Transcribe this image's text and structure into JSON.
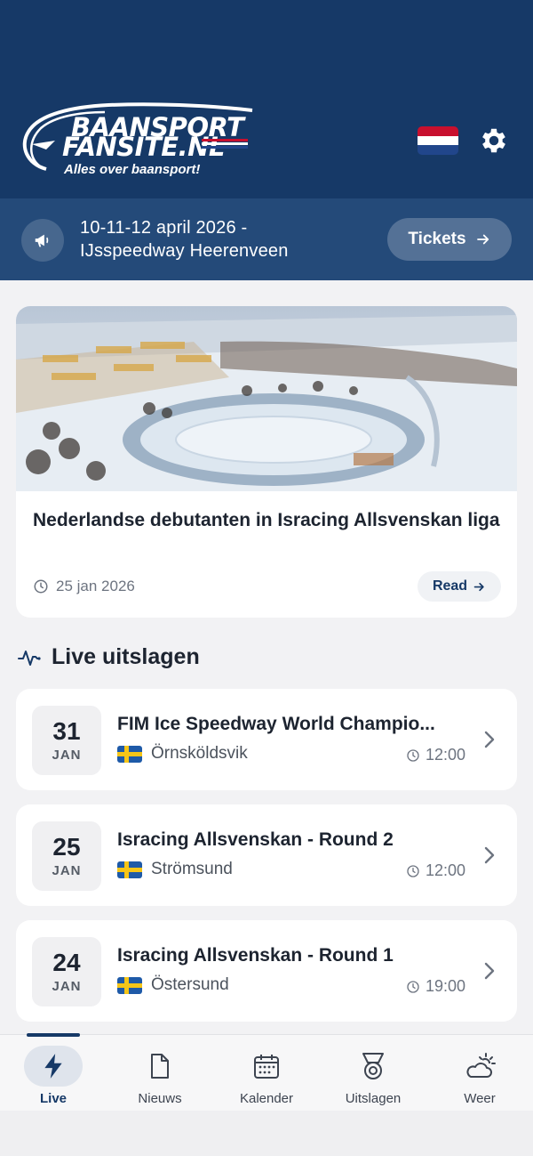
{
  "header": {
    "logo": {
      "line1": "BAANSPORT",
      "line2": "FANSITE.NL",
      "tagline": "Alles over baansport!"
    },
    "language_flag": "nl-flag",
    "settings_icon": "gear-icon"
  },
  "event_banner": {
    "icon": "megaphone-icon",
    "line1": "10-11-12 april 2026 -",
    "line2": "IJsspeedway Heerenveen",
    "button_label": "Tickets"
  },
  "featured_news": {
    "title": "Nederlandse debutanten in Isracing Allsvenskan liga",
    "date": "25 jan 2026",
    "read_label": "Read"
  },
  "live_section": {
    "title": "Live uitslagen",
    "icon": "activity-icon",
    "results": [
      {
        "day": "31",
        "month": "JAN",
        "title": "FIM Ice Speedway World Champio...",
        "location": "Örnsköldsvik",
        "time": "12:00",
        "flag": "se-flag"
      },
      {
        "day": "25",
        "month": "JAN",
        "title": "Isracing Allsvenskan - Round 2",
        "location": "Strömsund",
        "time": "12:00",
        "flag": "se-flag"
      },
      {
        "day": "24",
        "month": "JAN",
        "title": "Isracing Allsvenskan - Round 1",
        "location": "Östersund",
        "time": "19:00",
        "flag": "se-flag"
      }
    ]
  },
  "tabbar": {
    "tabs": [
      {
        "label": "Live",
        "icon": "lightning-icon",
        "active": true
      },
      {
        "label": "Nieuws",
        "icon": "document-icon",
        "active": false
      },
      {
        "label": "Kalender",
        "icon": "calendar-icon",
        "active": false
      },
      {
        "label": "Uitslagen",
        "icon": "medal-icon",
        "active": false
      },
      {
        "label": "Weer",
        "icon": "weather-icon",
        "active": false
      }
    ]
  },
  "colors": {
    "header_bg": "#163967",
    "banner_bg": "#244a79",
    "accent": "#163967",
    "page_bg": "#f2f2f4"
  }
}
